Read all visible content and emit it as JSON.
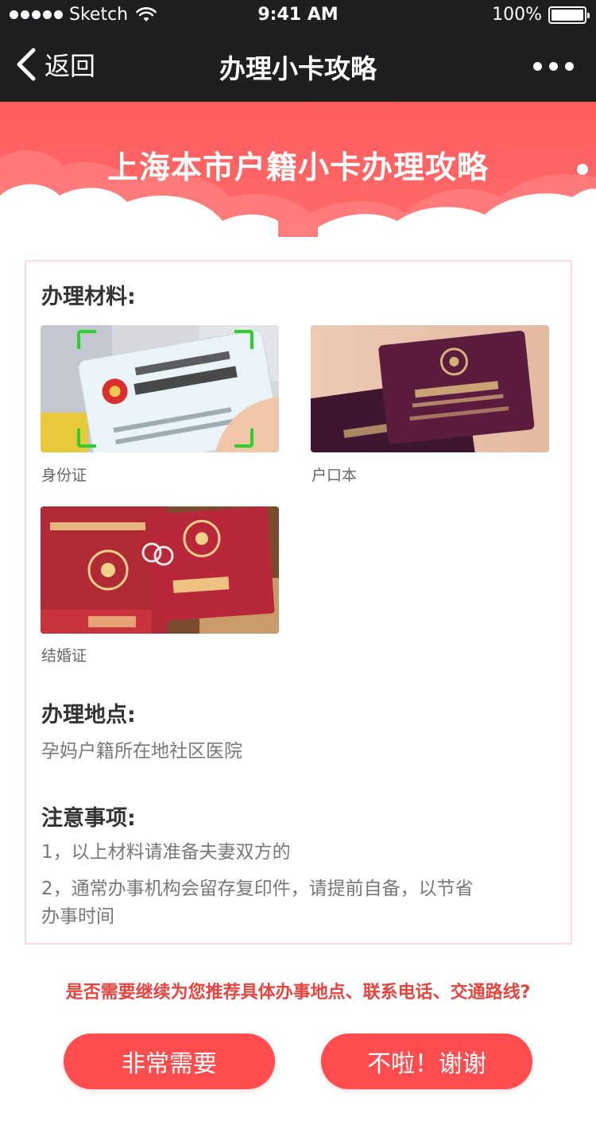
{
  "status_bar": {
    "carrier": "Sketch",
    "time": "9:41 AM",
    "battery_percent": "100%",
    "battery_level": 1.0
  },
  "nav": {
    "back_label": "返回",
    "title": "办理小卡攻略",
    "more_icon": "ellipsis-icon"
  },
  "banner": {
    "title": "上海本市户籍小卡办理攻略"
  },
  "card": {
    "materials_title": "办理材料:",
    "materials": [
      {
        "caption": "身份证",
        "icon": "id-card-photo"
      },
      {
        "caption": "户口本",
        "icon": "household-register-photo"
      },
      {
        "caption": "结婚证",
        "icon": "marriage-certificate-photo"
      }
    ],
    "location_title": "办理地点:",
    "location_text": "孕妈户籍所在地社区医院",
    "notes_title": "注意事项:",
    "notes": [
      "1，以上材料请准备夫妻双方的",
      "2，通常办事机构会留存复印件，请提前自备，以节省",
      "办事时间"
    ]
  },
  "question": "是否需要继续为您推荐具体办事地点、联系电话、交通路线?",
  "buttons": {
    "yes": "非常需要",
    "no": "不啦！谢谢"
  },
  "colors": {
    "accent": "#ff4d4f",
    "banner": "#ff5d5d",
    "nav_bg": "#1f1f21",
    "question": "#e8443f"
  }
}
